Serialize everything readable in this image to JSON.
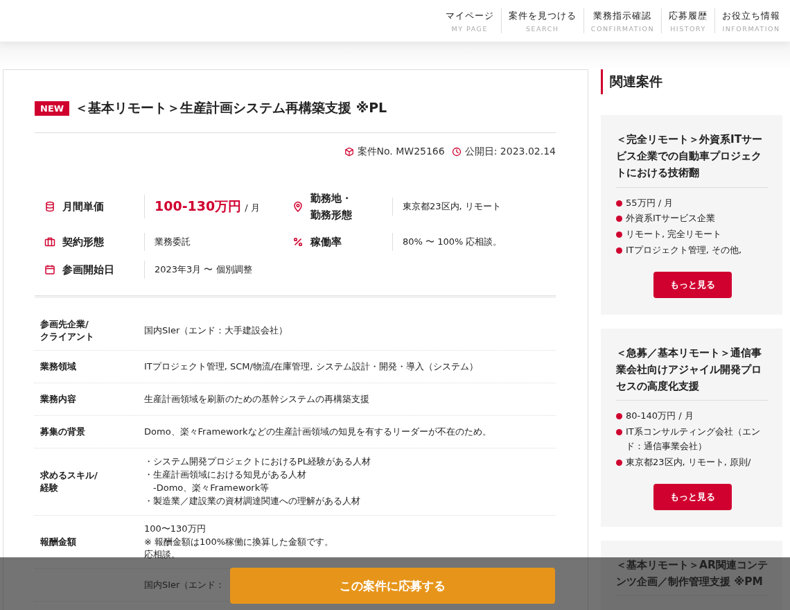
{
  "nav": [
    {
      "label": "マイページ",
      "sub": "MY PAGE"
    },
    {
      "label": "案件を見つける",
      "sub": "SEARCH"
    },
    {
      "label": "業務指示確認",
      "sub": "CONFIRMATION"
    },
    {
      "label": "応募履歴",
      "sub": "HISTORY"
    },
    {
      "label": "お役立ち情報",
      "sub": "INFORMATION"
    }
  ],
  "job": {
    "badge": "NEW",
    "title": "＜基本リモート＞生産計画システム再構築支援 ※PL",
    "number": "案件No. MW25166",
    "published": "公開日: 2023.02.14",
    "summary_rows": [
      {
        "items": [
          {
            "kind": "price",
            "label": "月間単価",
            "value": "100-130万円",
            "unit": "/ 月"
          },
          {
            "kind": "location",
            "label": "勤務地・勤務形態",
            "value": "東京都23区内, リモート"
          }
        ]
      },
      {
        "items": [
          {
            "kind": "contract",
            "label": "契約形態",
            "value": "業務委託"
          },
          {
            "kind": "rate",
            "label": "稼働率",
            "value": "80% 〜 100% 応相談。"
          }
        ]
      },
      {
        "items": [
          {
            "kind": "start",
            "label": "参画開始日",
            "value": "2023年3月 〜 個別調整"
          }
        ]
      }
    ],
    "details": [
      {
        "label": "参画先企業/\nクライアント",
        "value": "国内SIer（エンド：大手建設会社）"
      },
      {
        "label": "業務領域",
        "value": "ITプロジェクト管理, SCM/物流/在庫管理, システム設計・開発・導入（システム）"
      },
      {
        "label": "業務内容",
        "value": "生産計画領域を刷新のための基幹システムの再構築支援"
      },
      {
        "label": "募集の背景",
        "value": "Domo、楽々Frameworkなどの生産計画領域の知見を有するリーダーが不在のため。"
      },
      {
        "label": "求めるスキル/\n経験",
        "lines": [
          "・システム開発プロジェクトにおけるPL経験がある人材",
          "・生産計画領域における知見がある人材",
          "　-Domo、楽々Framework等",
          "・製造業／建設業の資材調達関連への理解がある人材"
        ]
      },
      {
        "label": "報酬金額",
        "lines": [
          "100〜130万円",
          "※ 報酬金額は100%稼働に換算した金額です。",
          "応相談。"
        ]
      },
      {
        "value": "国内SIer（エンド："
      }
    ]
  },
  "related": {
    "heading": "関連案件",
    "cards": [
      {
        "title": "＜完全リモート＞外資系ITサービス企業での自動車プロジェクトにおける技術翻",
        "facts": [
          "55万円 / 月",
          "外資系ITサービス企業",
          "リモート, 完全リモート",
          "ITプロジェクト管理, その他,"
        ],
        "button": "もっと見る"
      },
      {
        "title": "＜急募／基本リモート＞通信事業会社向けアジャイル開発プロセスの高度化支援",
        "facts": [
          "80-140万円 / 月",
          "IT系コンサルティング会社（エンド：通信事業会社）",
          "東京都23区内, リモート, 原則/"
        ],
        "button": "もっと見る"
      },
      {
        "title": "＜基本リモート＞AR関連コンテンツ企画／制作管理支援 ※PM"
      }
    ]
  },
  "apply_button": "この案件に応募する"
}
